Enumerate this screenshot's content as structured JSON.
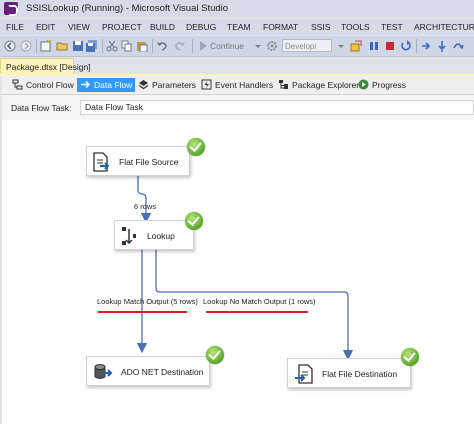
{
  "window": {
    "title": "SSISLookup (Running) - Microsoft Visual Studio"
  },
  "menu": [
    "FILE",
    "EDIT",
    "VIEW",
    "PROJECT",
    "BUILD",
    "DEBUG",
    "TEAM",
    "FORMAT",
    "SSIS",
    "TOOLS",
    "TEST",
    "ARCHITECTURE"
  ],
  "toolbar": {
    "continue_label": "Continue",
    "config_value": "Developi"
  },
  "document_tab": {
    "label": "Package.dtsx [Design]"
  },
  "designer_tabs": [
    {
      "label": "Control Flow",
      "icon": "control-flow-icon"
    },
    {
      "label": "Data Flow",
      "icon": "data-flow-icon",
      "selected": true
    },
    {
      "label": "Parameters",
      "icon": "parameters-icon"
    },
    {
      "label": "Event Handlers",
      "icon": "event-handlers-icon"
    },
    {
      "label": "Package Explorer",
      "icon": "package-explorer-icon"
    },
    {
      "label": "Progress",
      "icon": "progress-icon"
    }
  ],
  "task": {
    "label": "Data Flow Task:",
    "value": "Data Flow Task"
  },
  "components": {
    "flat_file_source": {
      "label": "Flat File Source",
      "icon": "flat-file-source-icon",
      "status": "success"
    },
    "lookup": {
      "label": "Lookup",
      "icon": "lookup-icon",
      "status": "success"
    },
    "ado_net_destination": {
      "label": "ADO NET Destination",
      "icon": "ado-net-destination-icon",
      "status": "success"
    },
    "flat_file_destination": {
      "label": "Flat File Destination",
      "icon": "flat-file-destination-icon",
      "status": "success"
    }
  },
  "paths": {
    "source_to_lookup": "6 rows",
    "match_output": "Lookup Match Output (5 rows)",
    "no_match_output": "Lookup No Match Output (1 rows)"
  },
  "colors": {
    "path_line": "#4a6fb5",
    "annotation_underline": "#e02020",
    "selected_tab": "#3399ff",
    "success": "#5aa62a"
  }
}
